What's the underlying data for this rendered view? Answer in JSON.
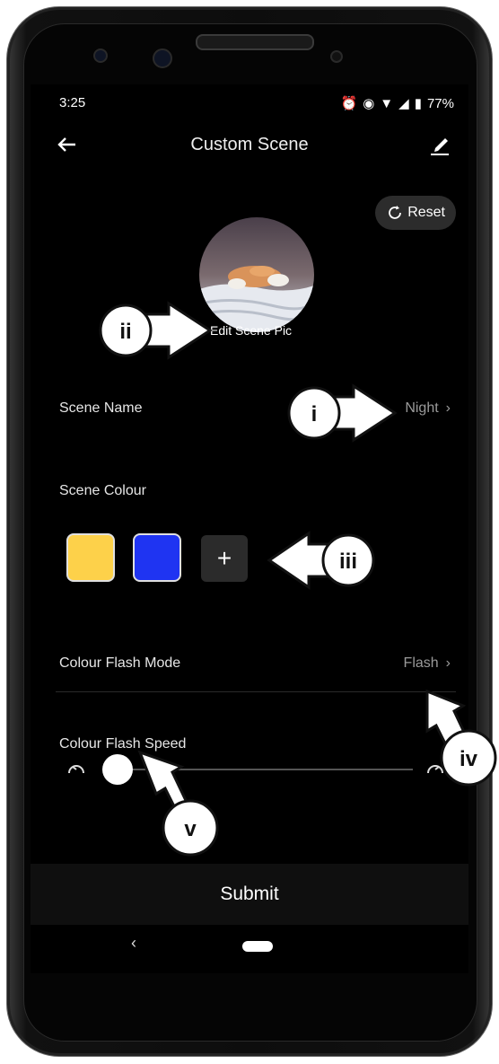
{
  "status": {
    "time": "3:25",
    "battery": "77%"
  },
  "appbar": {
    "title": "Custom Scene"
  },
  "reset": {
    "label": "Reset"
  },
  "scene_pic": {
    "edit_label": "Edit Scene Pic"
  },
  "scene_name": {
    "label": "Scene Name",
    "value": "Night"
  },
  "scene_colour": {
    "label": "Scene Colour",
    "swatches": [
      "#fdd14a",
      "#1f34f2"
    ],
    "add_label": "+"
  },
  "flash_mode": {
    "label": "Colour Flash Mode",
    "value": "Flash"
  },
  "flash_speed": {
    "label": "Colour Flash Speed",
    "level": 0
  },
  "submit": {
    "label": "Submit"
  },
  "callouts": {
    "i": "i",
    "ii": "ii",
    "iii": "iii",
    "iv": "iv",
    "v": "v"
  }
}
